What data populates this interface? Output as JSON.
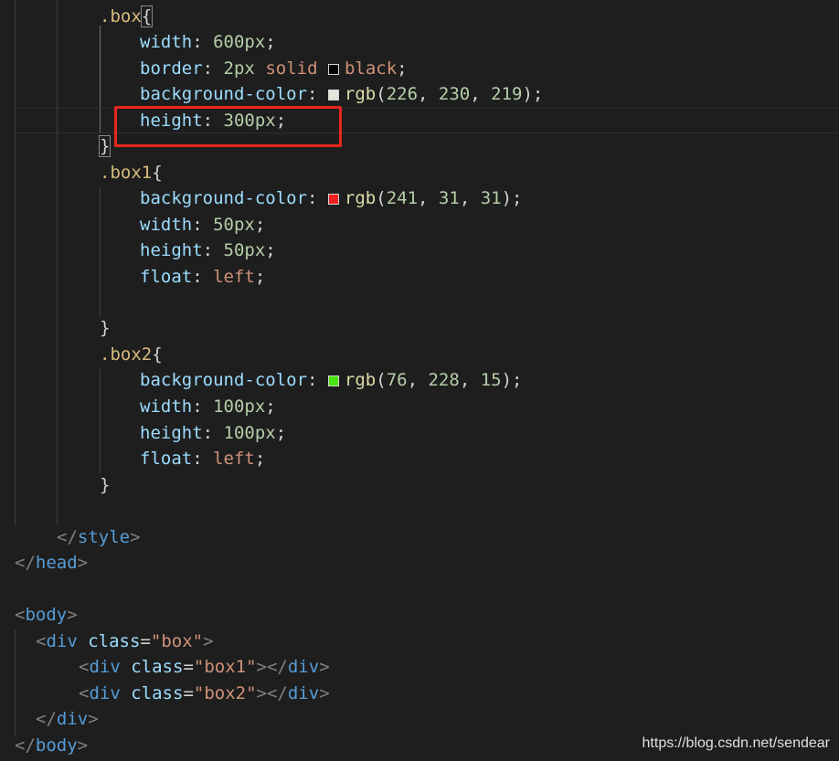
{
  "code": {
    "box_selector": ".box",
    "box_width_prop": "width",
    "box_width_val": "600px",
    "box_border_prop": "border",
    "box_border_num": "2px",
    "box_border_style": "solid",
    "box_border_color": "black",
    "box_bg_prop": "background-color",
    "box_bg_fn": "rgb",
    "box_bg_args": [
      "226",
      "230",
      "219"
    ],
    "box_height_prop": "height",
    "box_height_val": "300px",
    "box1_selector": ".box1",
    "box1_bg_prop": "background-color",
    "box1_bg_fn": "rgb",
    "box1_bg_args": [
      "241",
      "31",
      "31"
    ],
    "box1_width_prop": "width",
    "box1_width_val": "50px",
    "box1_height_prop": "height",
    "box1_height_val": "50px",
    "box1_float_prop": "float",
    "box1_float_val": "left",
    "box2_selector": ".box2",
    "box2_bg_prop": "background-color",
    "box2_bg_fn": "rgb",
    "box2_bg_args": [
      "76",
      "228",
      "15"
    ],
    "box2_width_prop": "width",
    "box2_width_val": "100px",
    "box2_height_prop": "height",
    "box2_height_val": "100px",
    "box2_float_prop": "float",
    "box2_float_val": "left",
    "style_tag": "style",
    "head_tag": "head",
    "body_tag": "body",
    "div_tag": "div",
    "class_attr": "class",
    "box_class_str": "\"box\"",
    "box1_class_str": "\"box1\"",
    "box2_class_str": "\"box2\""
  },
  "swatch_colors": {
    "black": "#000000",
    "box_bg": "#e2e6db",
    "box1_bg": "#f11f1f",
    "box2_bg": "#4ce40f"
  },
  "watermark": "https://blog.csdn.net/sendear"
}
